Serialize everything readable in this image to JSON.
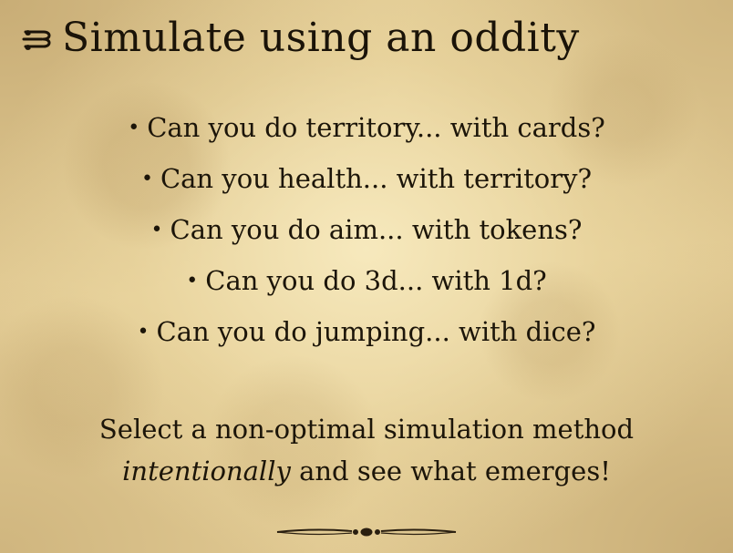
{
  "slide": {
    "title": "Simulate using an oddity",
    "title_icon": "scroll-flourish-icon",
    "bullets": [
      "Can you do territory... with cards?",
      "Can you health... with territory?",
      "Can you do aim... with tokens?",
      "Can you do 3d... with 1d?",
      "Can you do jumping... with dice?"
    ],
    "footer": {
      "line1": "Select a non-optimal simulation method",
      "line2_emphasis": "intentionally",
      "line2_rest": " and see what emerges!"
    },
    "ornament_icon": "divider-flourish-icon",
    "colors": {
      "parchment": "#e3cc95",
      "ink": "#1c1509"
    }
  }
}
